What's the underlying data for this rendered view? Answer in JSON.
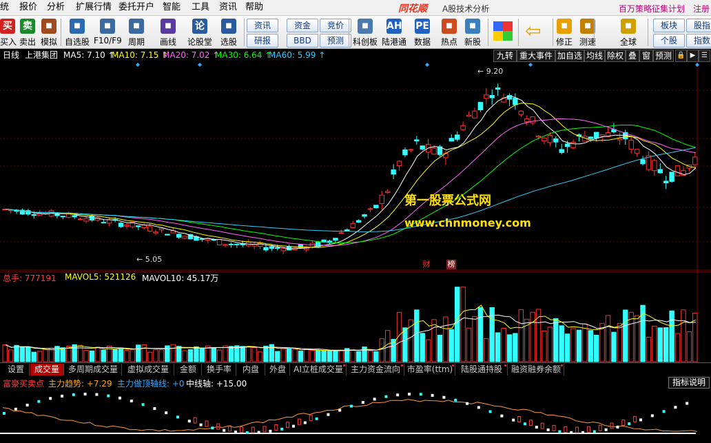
{
  "menu": {
    "items": [
      "统",
      "报价",
      "分析",
      "扩展行情",
      "委托开户",
      "智能",
      "工具",
      "资讯",
      "帮助"
    ],
    "logo": "同花顺",
    "app_title": "A股技术分析",
    "promo": "百万策略征集计划",
    "register": "注册"
  },
  "toolbar": {
    "buttons": [
      {
        "label": "买入",
        "icon": "买",
        "color": "#d42020"
      },
      {
        "label": "卖出",
        "icon": "卖",
        "color": "#1a8a2a"
      },
      {
        "label": "模拟",
        "icon": "hammer-icon",
        "color": "#a04a20"
      },
      {
        "label": "自选股",
        "icon": "watchlist-icon",
        "color": "#2a6ab0"
      },
      {
        "label": "F10/F9",
        "icon": "f10-icon",
        "color": "#3a6aa0"
      },
      {
        "label": "周期",
        "icon": "clock-icon",
        "color": "#3a6aa0"
      },
      {
        "label": "画线",
        "icon": "pencil-icon",
        "color": "#5a3aa0"
      },
      {
        "label": "论股堂",
        "icon": "论",
        "color": "#2a5aa0"
      },
      {
        "label": "选股",
        "icon": "magnifier-icon",
        "color": "#2a5aa0"
      },
      {
        "label": "科创板",
        "icon": "chart-icon",
        "color": "#4a7ab0"
      },
      {
        "label": "陆港通",
        "icon": "AH",
        "color": "#2060c0"
      },
      {
        "label": "数据",
        "icon": "PE",
        "color": "#2060c0"
      },
      {
        "label": "热点",
        "icon": "hot-icon",
        "color": "#d04a20"
      },
      {
        "label": "新股",
        "icon": "new-stock-icon",
        "color": "#3a80c0"
      },
      {
        "label": "修正",
        "icon": "up-down-icon",
        "color": "#e8a000"
      },
      {
        "label": "测速",
        "icon": "speed-icon",
        "color": "#c08000"
      },
      {
        "label": "全球",
        "icon": "globe-icon",
        "color": "#d0a000"
      }
    ],
    "small_buttons": [
      "资讯",
      "资金",
      "竞价",
      "研报",
      "BBD",
      "预测",
      "板块",
      "股指",
      "个股",
      "指数"
    ]
  },
  "chart_header": {
    "period": "日线",
    "stock": "上港集团",
    "ma": [
      {
        "label": "MA5: 7.10",
        "color": "#ffffff"
      },
      {
        "label": "MA10: 7.15",
        "color": "#ffff00"
      },
      {
        "label": "MA20: 7.02",
        "color": "#ff66ff"
      },
      {
        "label": "MA30: 6.64",
        "color": "#00ff00"
      },
      {
        "label": "MA60: 5.99",
        "color": "#33ccff"
      }
    ],
    "right_buttons": [
      "九转",
      "重大事件",
      "加自选",
      "均线",
      "除权",
      "叠",
      "窗",
      "预测"
    ]
  },
  "annotations": {
    "high": "9.20",
    "low": "5.05",
    "tag_cai": "财",
    "tag_bang": "榜"
  },
  "watermark": {
    "line1": "第一股票公式网",
    "line2": "www.chnmoney.com"
  },
  "volume_header": {
    "total": "总手: 777191",
    "mavol5": "MAVOL5: 521126",
    "mavol10": "MAVOL10: 45.17万"
  },
  "tabs": [
    "设置",
    "成交量",
    "多周期成交量",
    "虚拟成交量",
    "金额",
    "换手率",
    "内盘",
    "外盘",
    "AI立桩成交量",
    "主力资金流向",
    "市盈率(ttm)",
    "陆股通持股",
    "融资融券余额"
  ],
  "indicator_header": {
    "name": "富豪买卖点",
    "trend": "主力趋势: +7.29",
    "axis": "主力做顶轴线: +0",
    "mid": "中线轴: +15.00",
    "explain": "指标说明"
  },
  "chart_data": {
    "type": "candlestick",
    "series_count": 120,
    "price_range": [
      5.0,
      9.3
    ],
    "highest": 9.2,
    "lowest": 5.05,
    "ma_last": {
      "MA5": 7.1,
      "MA10": 7.15,
      "MA20": 7.02,
      "MA30": 6.64,
      "MA60": 5.99
    },
    "volume_last": 777191,
    "mavol5": 521126,
    "mavol10_wan": 45.17
  }
}
